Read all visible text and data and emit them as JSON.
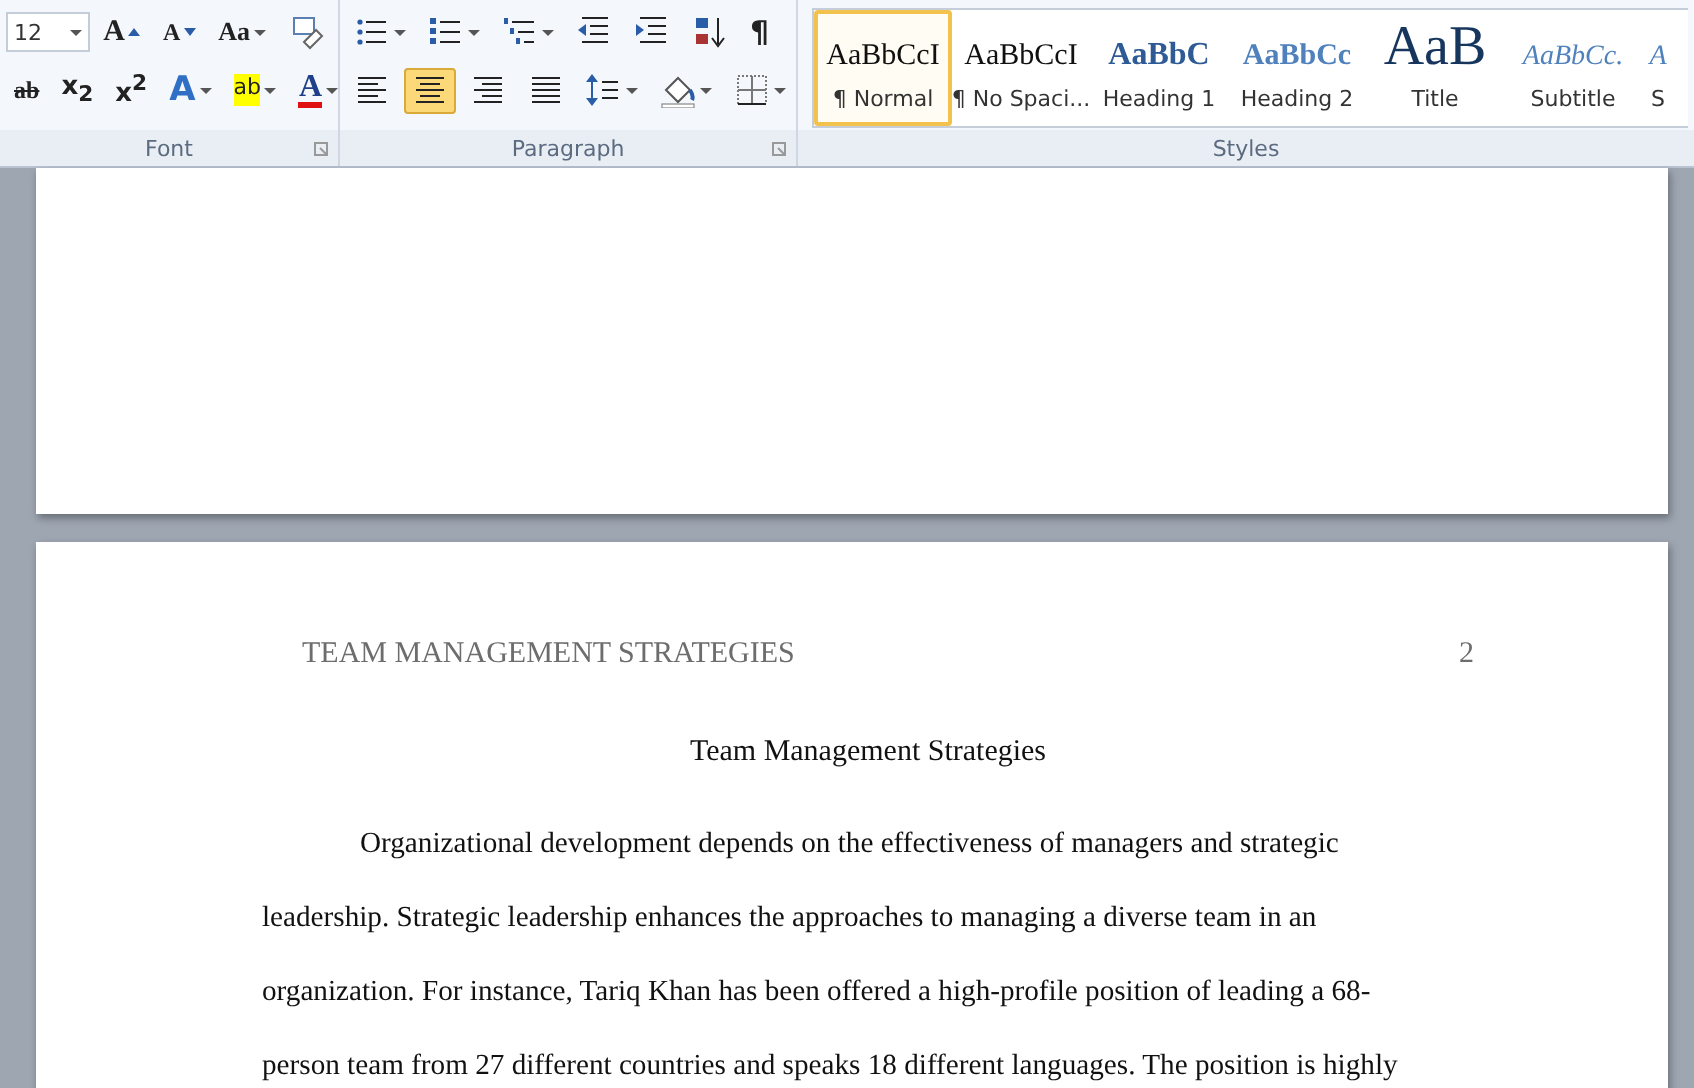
{
  "ribbon": {
    "groups": [
      {
        "label": "Font",
        "font_size": "12",
        "tool_rows": [
          [
            {
              "kind": "grow",
              "text": "A"
            },
            {
              "kind": "shrink",
              "text": "A"
            },
            {
              "kind": "case",
              "text": "Aa",
              "dropdown": true
            },
            {
              "kind": "clear"
            }
          ],
          [
            {
              "kind": "strike",
              "text": "ab"
            },
            {
              "kind": "subscript",
              "text": "x$_{2}$"
            },
            {
              "kind": "superscript",
              "text": "x$^{2}$"
            },
            {
              "kind": "effects",
              "text": "A",
              "dropdown": true
            },
            {
              "kind": "highlight",
              "text": "ab",
              "dropdown": true
            },
            {
              "kind": "fontcolor",
              "text": "A",
              "dropdown": true
            }
          ]
        ]
      },
      {
        "label": "Paragraph",
        "tool_rows": [
          [
            {
              "kind": "bullets",
              "dropdown": true
            },
            {
              "kind": "numbering",
              "dropdown": true
            },
            {
              "kind": "multilevel",
              "dropdown": true
            },
            {
              "kind": "outdent"
            },
            {
              "kind": "indent"
            },
            {
              "kind": "sort"
            },
            {
              "kind": "pilcrow",
              "text": "¶"
            }
          ],
          [
            {
              "kind": "left",
              "selected": false
            },
            {
              "kind": "center",
              "selected": true
            },
            {
              "kind": "right",
              "selected": false
            },
            {
              "kind": "justify",
              "selected": false
            },
            {
              "kind": "spacing",
              "dropdown": true,
              "selected": false
            },
            {
              "kind": "shading",
              "dropdown": true,
              "selected": false
            },
            {
              "kind": "borders",
              "dropdown": true,
              "selected": false
            }
          ]
        ]
      },
      {
        "label": "Styles",
        "styles": [
          {
            "kind": "normal",
            "sample": "AaBbCcI",
            "name": "¶ Normal",
            "selected": true
          },
          {
            "kind": "normal",
            "sample": "AaBbCcI",
            "name": "¶ No Spaci...",
            "selected": false
          },
          {
            "kind": "heading1",
            "sample": "AaBbC",
            "name": "Heading 1",
            "selected": false
          },
          {
            "kind": "heading2",
            "sample": "AaBbCc",
            "name": "Heading 2",
            "selected": false
          },
          {
            "kind": "title",
            "sample": "AaB",
            "name": "Title",
            "selected": false
          },
          {
            "kind": "subtitle",
            "sample": "AaBbCc.",
            "name": "Subtitle",
            "selected": false
          },
          {
            "kind": "subtitle",
            "sample": "A",
            "name": "S",
            "selected": false
          }
        ]
      }
    ]
  },
  "document": {
    "header": {
      "text": "TEAM MANAGEMENT STRATEGIES",
      "page_number": "2"
    },
    "title": "Team Management Strategies",
    "body_lines": [
      "Organizational development depends on the effectiveness of managers and strategic",
      "leadership. Strategic leadership enhances the approaches to managing a diverse team in an",
      "organization. For instance, Tariq Khan has been offered a high-profile position of leading a 68-",
      "person team from 27 different countries and speaks 18 different languages. The position is highly"
    ]
  }
}
